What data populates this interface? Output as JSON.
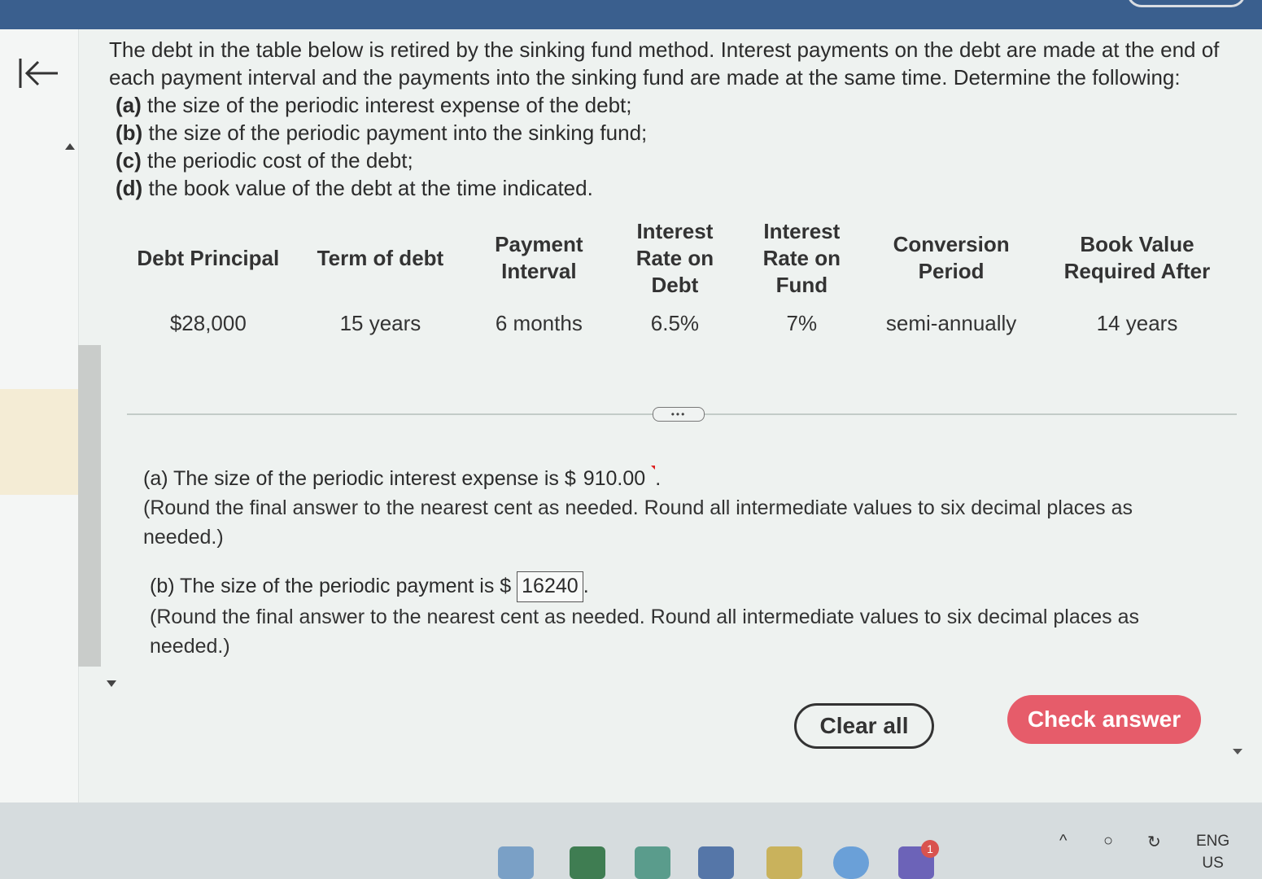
{
  "question": {
    "intro": "The debt in the table below is retired by the sinking fund method. Interest payments on the debt are made at the end of each payment interval and the payments into the sinking fund are made at the same time. Determine the following:",
    "parts": [
      {
        "label": "(a)",
        "text": "the size of the periodic interest expense of the debt;"
      },
      {
        "label": "(b)",
        "text": "the size of the periodic payment into the sinking fund;"
      },
      {
        "label": "(c)",
        "text": "the periodic cost of the debt;"
      },
      {
        "label": "(d)",
        "text": "the book value of the debt at the time indicated."
      }
    ]
  },
  "table": {
    "headers": [
      "Debt Principal",
      "Term of debt",
      "Payment Interval",
      "Interest Rate on Debt",
      "Interest Rate on Fund",
      "Conversion Period",
      "Book Value Required After"
    ],
    "row": [
      "$28,000",
      "15 years",
      "6 months",
      "6.5%",
      "7%",
      "semi-annually",
      "14 years"
    ]
  },
  "more_label": "•••",
  "answer_a": {
    "prefix": "(a) The size of the periodic interest expense is $",
    "value": "910.00",
    "suffix": ".",
    "note": "(Round the final answer to the nearest cent as needed. Round all intermediate values to six decimal places as needed.)"
  },
  "answer_b": {
    "prefix": "(b) The size of the periodic payment is $",
    "value": "16240",
    "suffix": ".",
    "note": "(Round the final answer to the nearest cent as needed. Round all intermediate values to six decimal places as needed.)"
  },
  "buttons": {
    "clear": "Clear all",
    "check": "Check answer"
  },
  "colors": {
    "check_button": "#e65c6a",
    "topbar": "#3a5f8e"
  },
  "taskbar": {
    "badge": "1",
    "lang_top": "ENG",
    "lang_bottom": "US"
  }
}
